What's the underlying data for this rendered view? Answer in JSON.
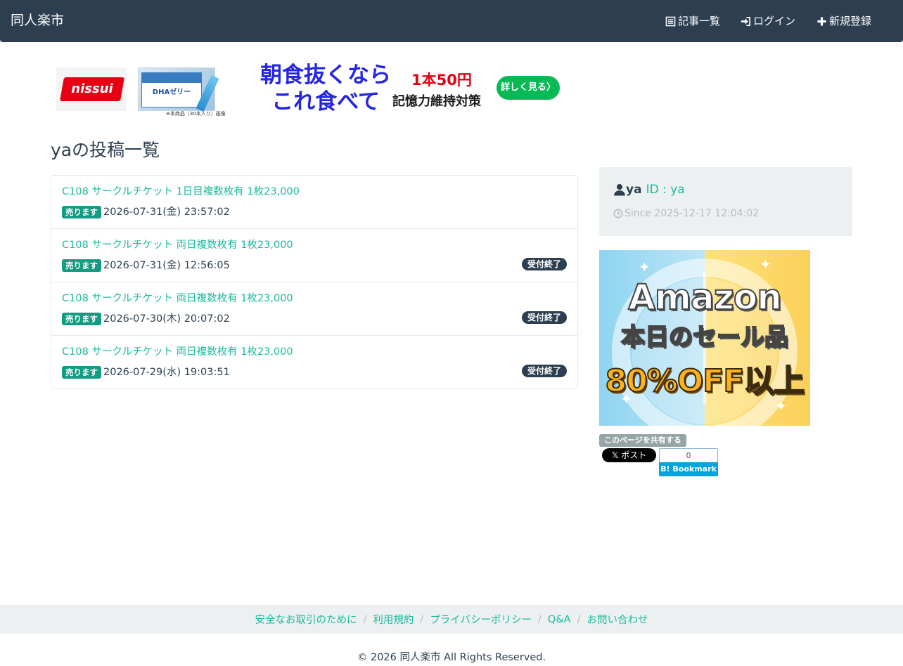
{
  "navbar": {
    "brand": "同人楽市",
    "items": [
      {
        "label": "記事一覧",
        "icon": "list-alt-icon"
      },
      {
        "label": "ログイン",
        "icon": "log-in-icon"
      },
      {
        "label": "新規登録",
        "icon": "plus-icon"
      }
    ]
  },
  "top_ad": {
    "logo_text": "nissui",
    "product_text": "DHAゼリー",
    "product_caption": "※本商品（30本入り）画像",
    "headline": "朝食抜くなら これ食べて",
    "price": "1本50円",
    "subline": "記憶力維持対策",
    "button": "詳しく見る〉"
  },
  "page": {
    "heading": "yaの投稿一覧"
  },
  "posts": [
    {
      "title": "C108 サークルチケット 1日目複数枚有 1枚23,000",
      "label": "売ります",
      "date": "2026-07-31(金) 23:57:02",
      "status": ""
    },
    {
      "title": "C108 サークルチケット 両日複数枚有 1枚23,000",
      "label": "売ります",
      "date": "2026-07-31(金) 12:56:05",
      "status": "受付終了"
    },
    {
      "title": "C108 サークルチケット 両日複数枚有 1枚23,000",
      "label": "売ります",
      "date": "2026-07-30(木) 20:07:02",
      "status": "受付終了"
    },
    {
      "title": "C108 サークルチケット 両日複数枚有 1枚23,000",
      "label": "売ります",
      "date": "2026-07-29(水) 19:03:51",
      "status": "受付終了"
    }
  ],
  "profile": {
    "name": "ya",
    "id_text": "ID : ya",
    "since": "Since 2025-12-17 12:04:02"
  },
  "side_ad": {
    "line1": "Amazon",
    "line2": "本日のセール品",
    "line3": "80%OFF以上"
  },
  "share": {
    "label": "このページを共有する",
    "x_button": "𝕏 ポスト",
    "hatena_count": "0",
    "hatena_button": "B! Bookmark"
  },
  "footer": {
    "links": [
      "安全なお取引のために",
      "利用規約",
      "プライバシーポリシー",
      "Q&A",
      "お問い合わせ"
    ],
    "copyright": "© 2026 同人楽市 All Rights Reserved."
  },
  "colors": {
    "navbar": "#2c3e50",
    "accent": "#18bc9c",
    "sell_label": "#149c82",
    "panel": "#ecf0f1"
  }
}
